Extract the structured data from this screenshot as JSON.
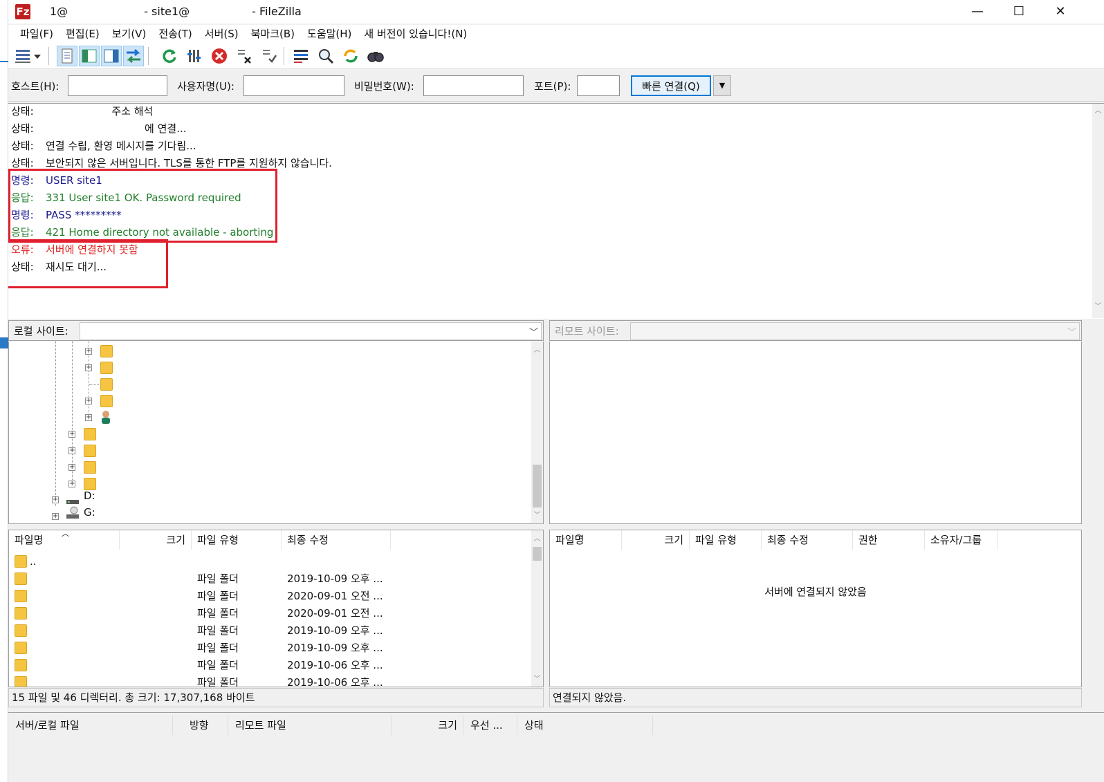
{
  "window": {
    "title_parts": [
      "1@",
      "- site1@",
      "- FileZilla"
    ],
    "app_icon_glyph": "Fz",
    "controls": {
      "minimize": "—",
      "maximize": "☐",
      "close": "✕"
    }
  },
  "menu": {
    "items": [
      "파일(F)",
      "편집(E)",
      "보기(V)",
      "전송(T)",
      "서버(S)",
      "북마크(B)",
      "도움말(H)",
      "새 버전이 있습니다!(N)"
    ]
  },
  "toolbar": {
    "icons": [
      "site-manager-icon",
      "dropdown-arrow-icon",
      "toggle-message-log-icon",
      "toggle-local-tree-icon",
      "toggle-remote-tree-icon",
      "toggle-transfer-queue-icon",
      "refresh-icon",
      "process-queue-icon",
      "cancel-icon",
      "disconnect-icon",
      "reconnect-icon",
      "directory-listing-filters-icon",
      "toggle-comparison-icon",
      "sync-browsing-icon",
      "search-icon"
    ]
  },
  "quickconnect": {
    "host_label": "호스트(H):",
    "user_label": "사용자명(U):",
    "pass_label": "비밀번호(W):",
    "port_label": "포트(P):",
    "button_label": "빠른 연결(Q)",
    "dropdown_glyph": "▼",
    "host_value": "",
    "user_value": "",
    "pass_value": "",
    "port_value": ""
  },
  "log": {
    "lines": [
      {
        "type": "상태:",
        "msg": "                    주소 해석",
        "kind": "status"
      },
      {
        "type": "상태:",
        "msg": "                              에 연결...",
        "kind": "status"
      },
      {
        "type": "상태:",
        "msg": "연결 수립, 환영 메시지를 기다림...",
        "kind": "status"
      },
      {
        "type": "상태:",
        "msg": "보안되지 않은 서버입니다. TLS를 통한 FTP를 지원하지 않습니다.",
        "kind": "status"
      },
      {
        "type": "명령:",
        "msg": "USER site1",
        "kind": "cmd"
      },
      {
        "type": "응답:",
        "msg": "331 User site1 OK. Password required",
        "kind": "resp"
      },
      {
        "type": "명령:",
        "msg": "PASS *********",
        "kind": "cmd"
      },
      {
        "type": "응답:",
        "msg": "421 Home directory not available - aborting",
        "kind": "resp"
      },
      {
        "type": "오류:",
        "msg": "서버에 연결하지 못함",
        "kind": "err"
      },
      {
        "type": "상태:",
        "msg": "재시도 대기...",
        "kind": "status"
      }
    ],
    "colors": {
      "status": "#111111",
      "cmd": "#1a1a8c",
      "resp": "#1e7d28",
      "err": "#e02020",
      "highlight": "#e0202f"
    }
  },
  "local": {
    "site_label": "로컬 사이트:",
    "site_path": "",
    "tree_drives": [
      "D:",
      "G:"
    ],
    "columns": [
      "파일명",
      "크기",
      "파일 유형",
      "최종 수정"
    ],
    "rows": [
      {
        "name": "..",
        "type": "",
        "modified": ""
      },
      {
        "name": "",
        "type": "파일 폴더",
        "modified": "2019-10-09 오후 ..."
      },
      {
        "name": "",
        "type": "파일 폴더",
        "modified": "2020-09-01 오전 ..."
      },
      {
        "name": "",
        "type": "파일 폴더",
        "modified": "2020-09-01 오전 ..."
      },
      {
        "name": "",
        "type": "파일 폴더",
        "modified": "2019-10-09 오후 ..."
      },
      {
        "name": "",
        "type": "파일 폴더",
        "modified": "2019-10-09 오후 ..."
      },
      {
        "name": "",
        "type": "파일 폴더",
        "modified": "2019-10-06 오후 ..."
      },
      {
        "name": "",
        "type": "파일 폴더",
        "modified": "2019-10-06 오후 ..."
      }
    ],
    "status": "15 파일 및 46 디렉터리. 총 크기: 17,307,168 바이트"
  },
  "remote": {
    "site_label": "리모트 사이트:",
    "columns": [
      "파일명",
      "크기",
      "파일 유형",
      "최종 수정",
      "권한",
      "소유자/그룹"
    ],
    "empty_message": "서버에 연결되지 않았음",
    "status": "연결되지 않았음."
  },
  "queue": {
    "columns": [
      "서버/로컬 파일",
      "방향",
      "리모트 파일",
      "크기",
      "우선 ...",
      "상태"
    ]
  }
}
